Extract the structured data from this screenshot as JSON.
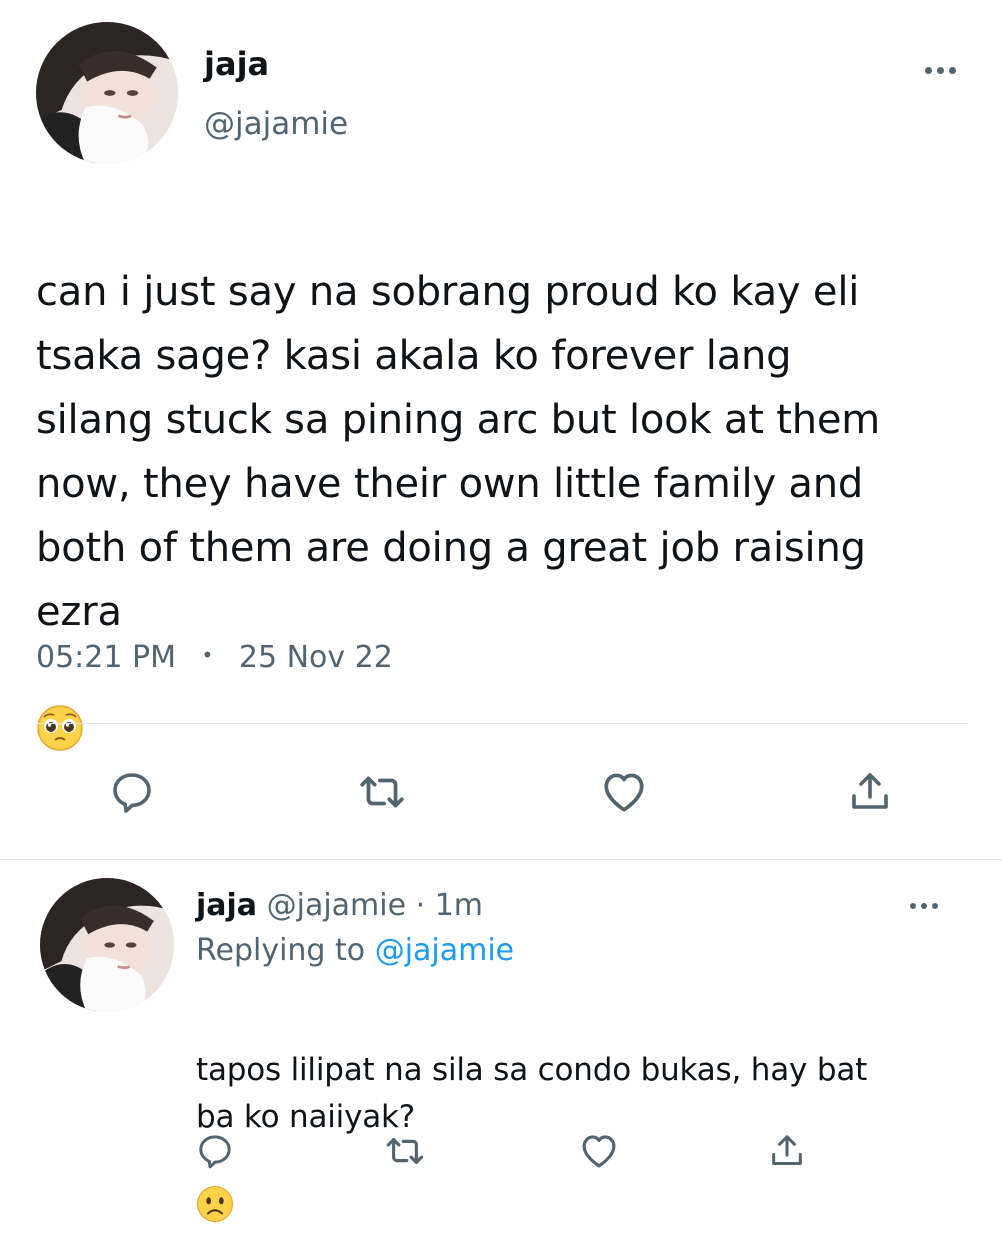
{
  "tweet": {
    "author_name": "jaja",
    "author_handle": "@jajamie",
    "text": "can i just say na sobrang proud ko kay eli\ntsaka sage? kasi akala ko forever lang\nsilang stuck sa pining arc but look at them\nnow, they have their own little family and\nboth of them are doing a great job raising\nezra",
    "emoji": "pleading-face",
    "time": "05:21 PM",
    "separator": "•",
    "date": "25 Nov 22",
    "more_icon": "more-horizontal-icon"
  },
  "actions": {
    "reply_icon": "reply-icon",
    "retweet_icon": "retweet-icon",
    "like_icon": "heart-icon",
    "share_icon": "share-icon"
  },
  "reply": {
    "author_name": "jaja",
    "author_handle": "@jajamie",
    "dot": "·",
    "time_ago": "1m",
    "replying_prefix": "Replying to",
    "replying_to": "@jajamie",
    "text": "tapos lilipat na sila sa condo bukas, hay bat\nba ko naiiyak?",
    "emoji": "frowning-face"
  },
  "colors": {
    "text": "#0f1419",
    "secondary": "#536471",
    "accent": "#1d9bf0",
    "divider": "#e1e8ed"
  }
}
